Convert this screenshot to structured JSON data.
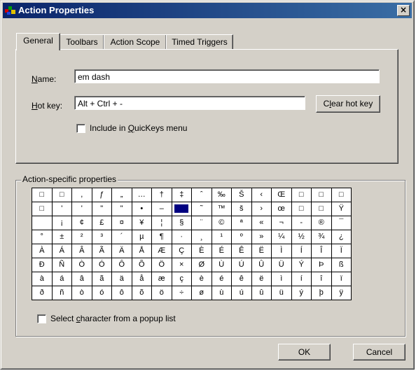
{
  "window": {
    "title": "Action Properties",
    "close_glyph": "×"
  },
  "tabs": [
    {
      "label": "General"
    },
    {
      "label": "Toolbars"
    },
    {
      "label": "Action Scope"
    },
    {
      "label": "Timed Triggers"
    }
  ],
  "general": {
    "name_label_u": "N",
    "name_label_rest": "ame:",
    "name_value": "em dash",
    "hotkey_label_u": "H",
    "hotkey_label_rest": "ot key:",
    "hotkey_value": "Alt + Ctrl + -",
    "clear_pre": "C",
    "clear_u": "l",
    "clear_post": "ear hot key",
    "quickeys_pre": "Include in ",
    "quickeys_u": "Q",
    "quickeys_post": "uicKeys menu",
    "quickeys_checked": false
  },
  "action_specific": {
    "group_label": "Action-specific properties",
    "selected_cell": {
      "row": 1,
      "col": 7
    },
    "grid": [
      [
        "□",
        "□",
        ",",
        "ƒ",
        "„",
        "…",
        "†",
        "‡",
        "ˆ",
        "‰",
        "Š",
        "‹",
        "Œ",
        "□",
        "□",
        "□"
      ],
      [
        "□",
        "'",
        "'",
        "\"",
        "\"",
        "•",
        "–",
        "",
        "˜",
        "™",
        "š",
        "›",
        "œ",
        "□",
        "□",
        "Ÿ"
      ],
      [
        " ",
        "¡",
        "¢",
        "£",
        "¤",
        "¥",
        "¦",
        "§",
        "¨",
        "©",
        "ª",
        "«",
        "¬",
        "-",
        "®",
        "¯"
      ],
      [
        "°",
        "±",
        "²",
        "³",
        "´",
        "µ",
        "¶",
        "·",
        "¸",
        "¹",
        "º",
        "»",
        "¼",
        "½",
        "¾",
        "¿"
      ],
      [
        "À",
        "Á",
        "Â",
        "Ã",
        "Ä",
        "Å",
        "Æ",
        "Ç",
        "È",
        "É",
        "Ê",
        "Ë",
        "Ì",
        "Í",
        "Î",
        "Ï"
      ],
      [
        "Ð",
        "Ñ",
        "Ò",
        "Ó",
        "Ô",
        "Õ",
        "Ö",
        "×",
        "Ø",
        "Ù",
        "Ú",
        "Û",
        "Ü",
        "Ý",
        "Þ",
        "ß"
      ],
      [
        "à",
        "á",
        "â",
        "ã",
        "ä",
        "å",
        "æ",
        "ç",
        "è",
        "é",
        "ê",
        "ë",
        "ì",
        "í",
        "î",
        "ï"
      ],
      [
        "ð",
        "ñ",
        "ò",
        "ó",
        "ô",
        "õ",
        "ö",
        "÷",
        "ø",
        "ù",
        "ú",
        "û",
        "ü",
        "ý",
        "þ",
        "ÿ"
      ]
    ],
    "popup_pre": "Select ",
    "popup_u": "c",
    "popup_post": "haracter from a popup list",
    "popup_checked": false
  },
  "footer": {
    "ok_label": "OK",
    "cancel_label": "Cancel"
  },
  "colors": {
    "title_start": "#0a246a",
    "title_end": "#3a6ea5",
    "face": "#d4d0c8",
    "selection": "#000080"
  }
}
